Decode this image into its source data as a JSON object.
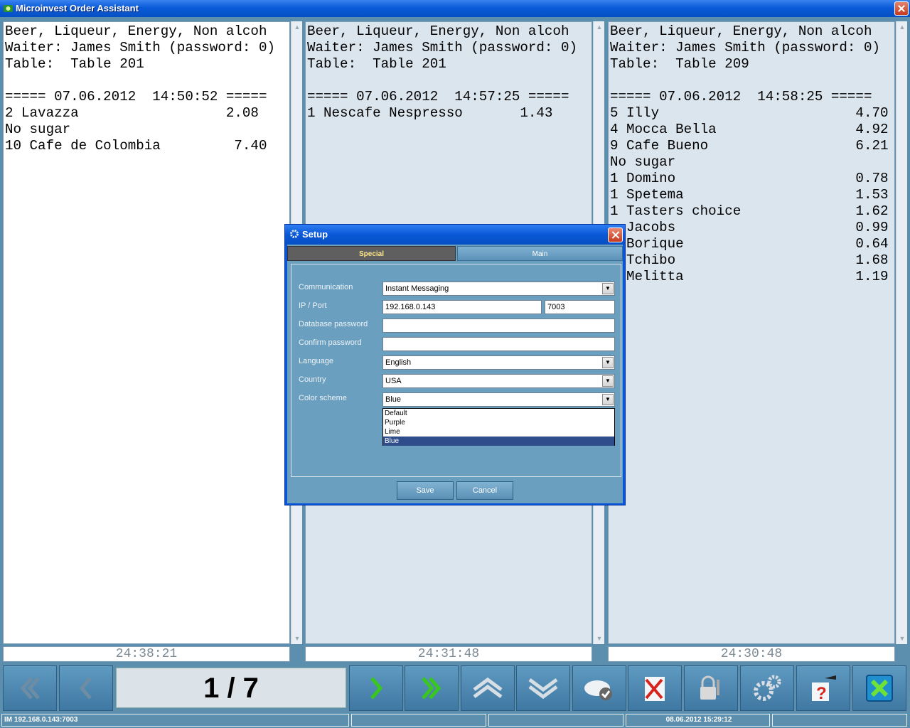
{
  "window": {
    "title": "Microinvest Order Assistant"
  },
  "panels": [
    {
      "lines": [
        "Beer, Liqueur, Energy, Non alcoh",
        "Waiter: James Smith (password: 0)",
        "Table:  Table 201",
        "",
        "===== 07.06.2012  14:50:52 =====",
        "2 Lavazza                  2.08",
        "No sugar",
        "10 Cafe de Colombia         7.40"
      ],
      "timer": "24:38:21"
    },
    {
      "lines": [
        "Beer, Liqueur, Energy, Non alcoh",
        "Waiter: James Smith (password: 0)",
        "Table:  Table 201",
        "",
        "===== 07.06.2012  14:57:25 =====",
        "1 Nescafe Nespresso       1.43"
      ],
      "timer": "24:31:48"
    },
    {
      "lines": [
        "Beer, Liqueur, Energy, Non alcoh",
        "Waiter: James Smith (password: 0)",
        "Table:  Table 209",
        "",
        "===== 07.06.2012  14:58:25 =====",
        "5 Illy                        4.70",
        "4 Mocca Bella                 4.92",
        "9 Cafe Bueno                  6.21",
        "No sugar",
        "1 Domino                      0.78",
        "1 Spetema                     1.53",
        "1 Tasters choice              1.62",
        "  Jacobs                      0.99",
        "  Borique                     0.64",
        "  Tchibo                      1.68",
        "  Melitta                     1.19"
      ],
      "timer": "24:30:48"
    }
  ],
  "toolbar": {
    "pager": "1 / 7",
    "buttons": [
      "first-page-icon",
      "previous-page-icon",
      "next-page-icon",
      "last-page-icon",
      "scroll-up-icon",
      "scroll-down-icon",
      "cloud-check-icon",
      "cancel-order-icon",
      "lock-key-icon",
      "settings-gears-icon",
      "help-icon",
      "exit-icon"
    ]
  },
  "status": {
    "connection": "IM  192.168.0.143:7003",
    "datetime": "08.06.2012 15:29:12"
  },
  "dialog": {
    "title": "Setup",
    "tabs": {
      "special": "Special",
      "main": "Main"
    },
    "labels": {
      "communication": "Communication",
      "ip_port": "IP / Port",
      "db_password": "Database password",
      "confirm_password": "Confirm password",
      "language": "Language",
      "country": "Country",
      "color_scheme": "Color scheme"
    },
    "values": {
      "communication": "Instant Messaging",
      "ip": "192.168.0.143",
      "port": "7003",
      "db_password": "",
      "confirm_password": "",
      "language": "English",
      "country": "USA",
      "color_scheme": "Blue"
    },
    "color_options": [
      "Default",
      "Purple",
      "Lime",
      "Blue"
    ],
    "buttons": {
      "save": "Save",
      "cancel": "Cancel"
    }
  },
  "colors": {
    "background": "#5c8fae",
    "titlebar": "#0a5bd8",
    "panel_alt": "#dbe5ee",
    "next_arrow": "#39c61f"
  }
}
